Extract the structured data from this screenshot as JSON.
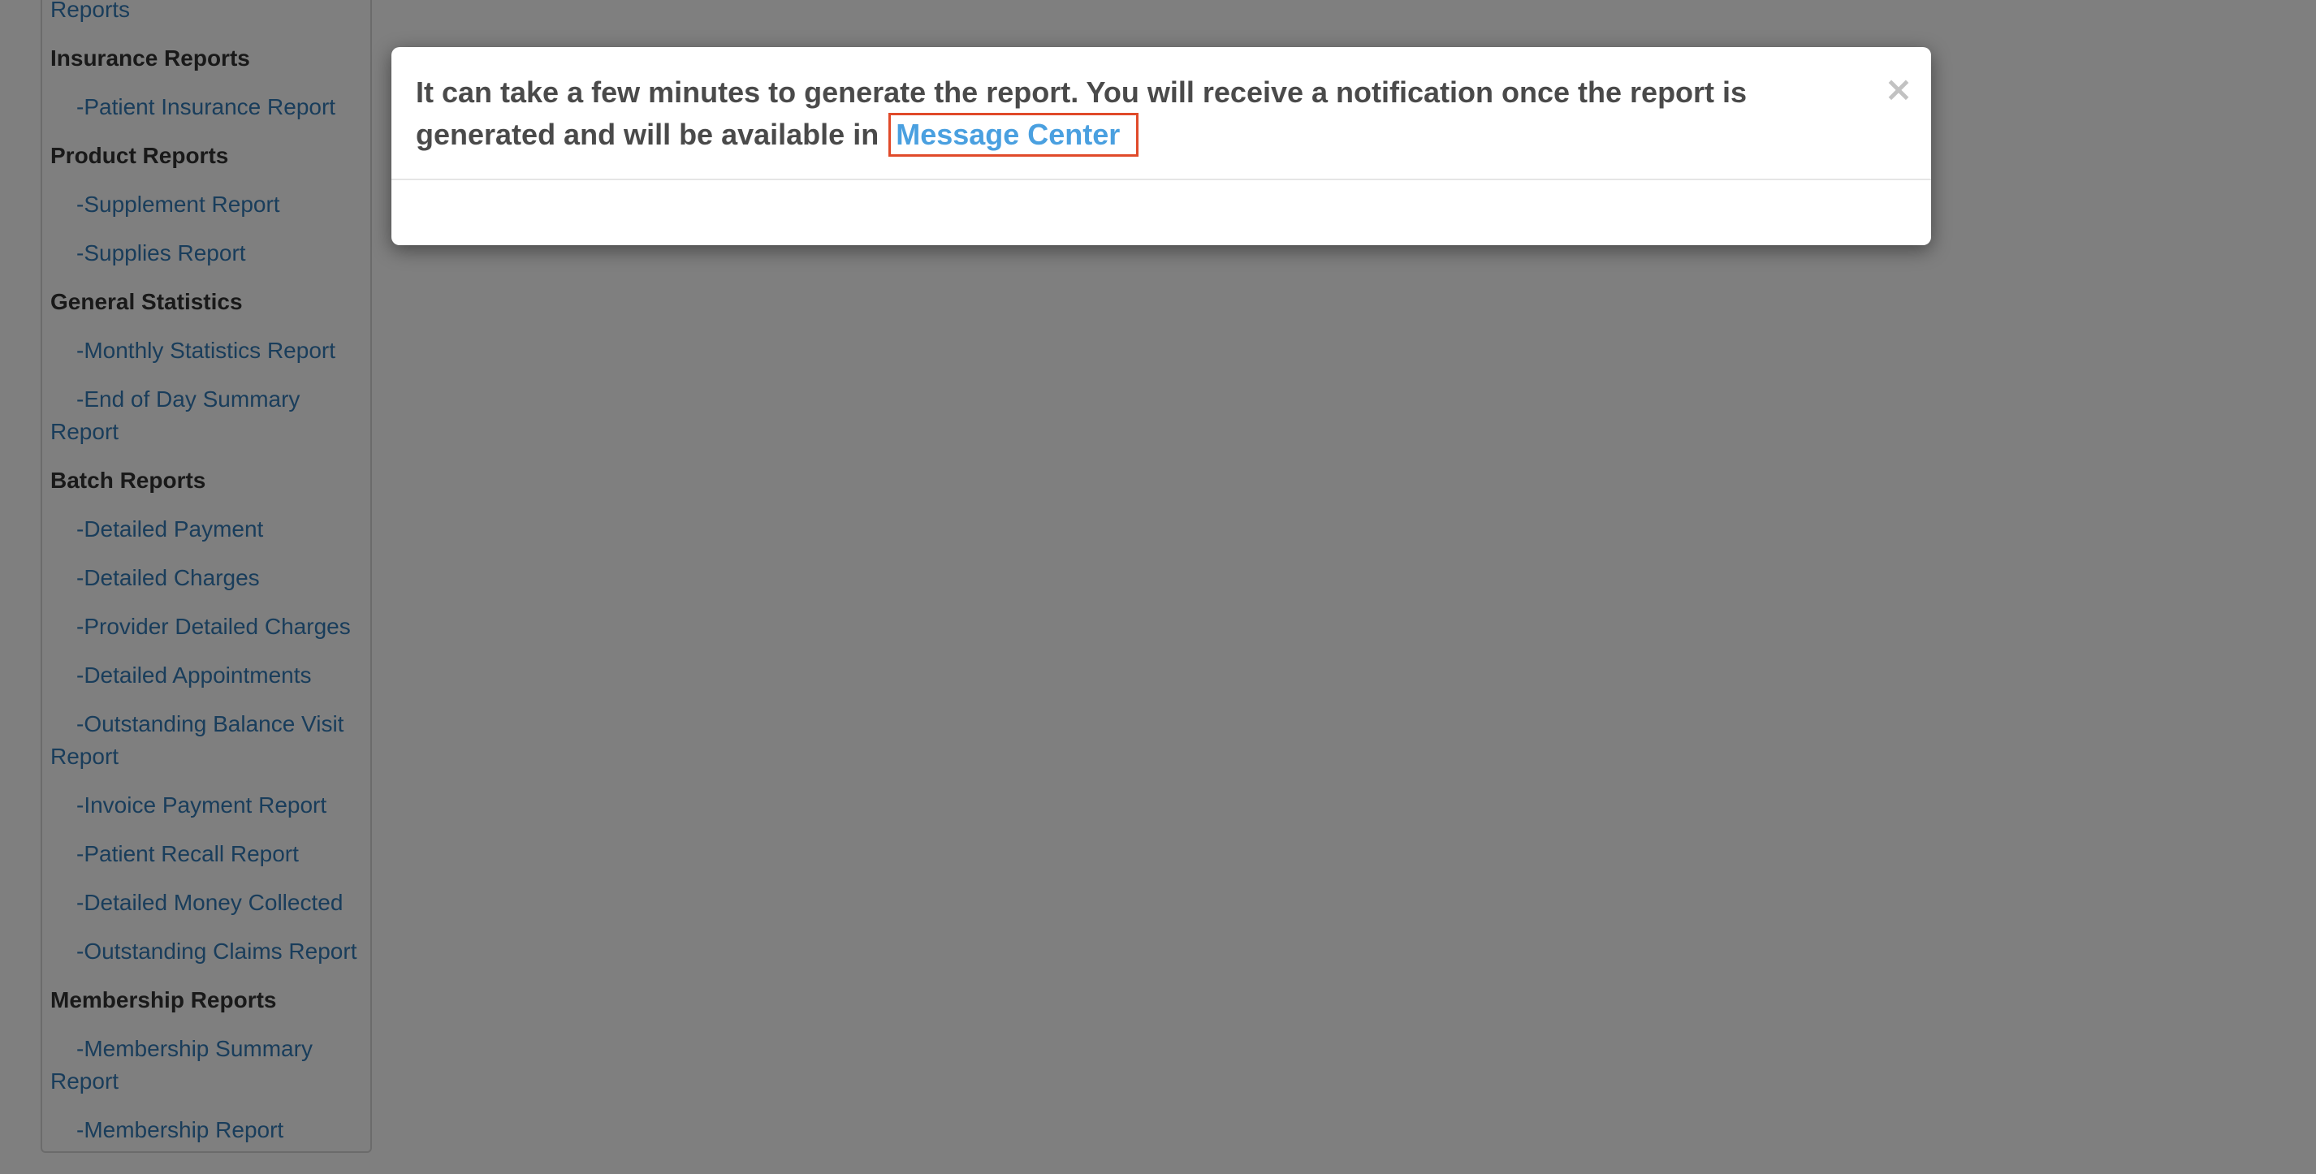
{
  "sidebar": {
    "items": [
      {
        "type": "link",
        "label": "Reports",
        "indent": false
      },
      {
        "type": "heading",
        "label": "Insurance Reports"
      },
      {
        "type": "link",
        "label": "-Patient Insurance Report",
        "indent": true
      },
      {
        "type": "heading",
        "label": "Product Reports"
      },
      {
        "type": "link",
        "label": "-Supplement Report",
        "indent": true
      },
      {
        "type": "link",
        "label": "-Supplies Report",
        "indent": true
      },
      {
        "type": "heading",
        "label": "General Statistics"
      },
      {
        "type": "link",
        "label": "-Monthly Statistics Report",
        "indent": true
      },
      {
        "type": "link",
        "label": "-End of Day Summary Report",
        "indent": true
      },
      {
        "type": "heading",
        "label": "Batch Reports"
      },
      {
        "type": "link",
        "label": "-Detailed Payment",
        "indent": true
      },
      {
        "type": "link",
        "label": "-Detailed Charges",
        "indent": true
      },
      {
        "type": "link",
        "label": "-Provider Detailed Charges",
        "indent": true
      },
      {
        "type": "link",
        "label": "-Detailed Appointments",
        "indent": true
      },
      {
        "type": "link",
        "label": "-Outstanding Balance Visit Report",
        "indent": true
      },
      {
        "type": "link",
        "label": "-Invoice Payment Report",
        "indent": true
      },
      {
        "type": "link",
        "label": "-Patient Recall Report",
        "indent": true
      },
      {
        "type": "link",
        "label": "-Detailed Money Collected",
        "indent": true
      },
      {
        "type": "link",
        "label": "-Outstanding Claims Report",
        "indent": true
      },
      {
        "type": "heading",
        "label": "Membership Reports"
      },
      {
        "type": "link",
        "label": "-Membership Summary Report",
        "indent": true
      },
      {
        "type": "link",
        "label": "-Membership Report",
        "indent": true
      }
    ]
  },
  "modal": {
    "message": "It can take a few minutes to generate the report. You will receive a notification once the report is generated and will be available in",
    "link_label": "Message Center",
    "close_label": "×"
  },
  "colors": {
    "link": "#337ab7",
    "modal_link": "#4aa0e0",
    "highlight_border": "#e04a2a",
    "heading": "#333333",
    "backdrop": "rgba(0,0,0,0.5)"
  }
}
